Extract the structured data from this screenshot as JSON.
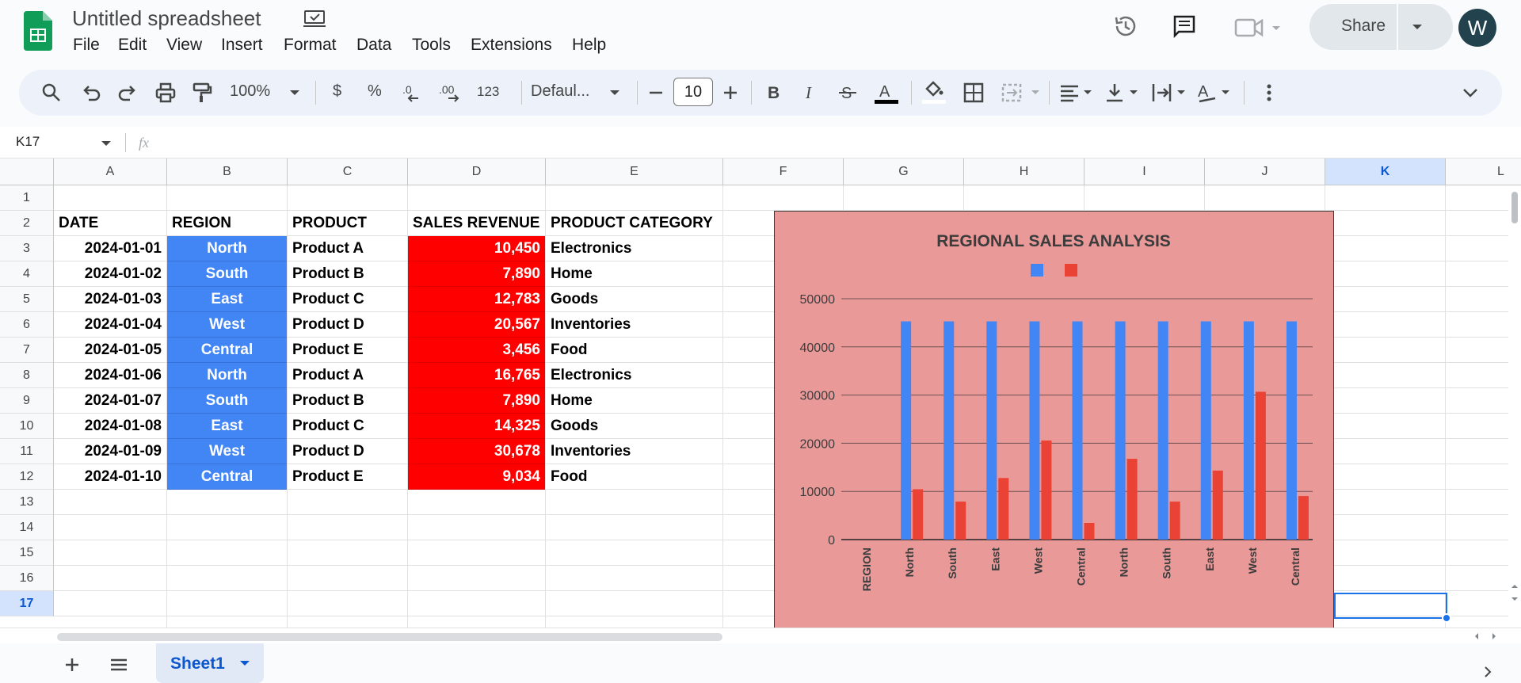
{
  "doc": {
    "title": "Untitled spreadsheet"
  },
  "menu": [
    "File",
    "Edit",
    "View",
    "Insert",
    "Format",
    "Data",
    "Tools",
    "Extensions",
    "Help"
  ],
  "share": {
    "label": "Share"
  },
  "user": {
    "initial": "W"
  },
  "toolbar": {
    "zoom": "100%",
    "currency": "$",
    "percent": "%",
    "more_formats": "123",
    "font": "Defaul...",
    "font_size": "10"
  },
  "namebox": {
    "cell": "K17"
  },
  "columns": [
    "A",
    "B",
    "C",
    "D",
    "E",
    "F",
    "G",
    "H",
    "I",
    "J",
    "K",
    "L"
  ],
  "rows": [
    "1",
    "2",
    "3",
    "4",
    "5",
    "6",
    "7",
    "8",
    "9",
    "10",
    "11",
    "12",
    "13",
    "14",
    "15",
    "16",
    "17"
  ],
  "table": {
    "headers": [
      "DATE",
      "REGION",
      "PRODUCT",
      "SALES REVENUE",
      "PRODUCT CATEGORY"
    ],
    "data": [
      [
        "2024-01-01",
        "North",
        "Product A",
        "10,450",
        "Electronics"
      ],
      [
        "2024-01-02",
        "South",
        "Product B",
        "7,890",
        "Home"
      ],
      [
        "2024-01-03",
        "East",
        "Product C",
        "12,783",
        "Goods"
      ],
      [
        "2024-01-04",
        "West",
        "Product D",
        "20,567",
        "Inventories"
      ],
      [
        "2024-01-05",
        "Central",
        "Product E",
        "3,456",
        "Food"
      ],
      [
        "2024-01-06",
        "North",
        "Product A",
        "16,765",
        "Electronics"
      ],
      [
        "2024-01-07",
        "South",
        "Product B",
        "7,890",
        "Home"
      ],
      [
        "2024-01-08",
        "East",
        "Product C",
        "14,325",
        "Goods"
      ],
      [
        "2024-01-09",
        "West",
        "Product D",
        "30,678",
        "Inventories"
      ],
      [
        "2024-01-10",
        "Central",
        "Product E",
        "9,034",
        "Food"
      ]
    ]
  },
  "sheet": {
    "tab": "Sheet1"
  },
  "colors": {
    "blue_series": "#4285f4",
    "red_series": "#ea4335",
    "chart_bg": "#ea9999",
    "region_fill": "#4285f4",
    "revenue_fill": "#ff0000"
  },
  "chart_data": {
    "type": "bar",
    "title": "REGIONAL SALES ANALYSIS",
    "categories": [
      "REGION",
      "North",
      "South",
      "East",
      "West",
      "Central",
      "North",
      "South",
      "East",
      "West",
      "Central"
    ],
    "series": [
      {
        "color": "#4285f4",
        "values": [
          null,
          45300,
          45300,
          45300,
          45300,
          45300,
          45300,
          45300,
          45300,
          45300,
          45300
        ]
      },
      {
        "color": "#ea4335",
        "values": [
          null,
          10450,
          7890,
          12783,
          20567,
          3456,
          16765,
          7890,
          14325,
          30678,
          9034
        ]
      }
    ],
    "yticks": [
      "0",
      "10000",
      "20000",
      "30000",
      "40000",
      "50000"
    ],
    "ylim": [
      0,
      50000
    ],
    "grid": true,
    "legend": "top"
  }
}
